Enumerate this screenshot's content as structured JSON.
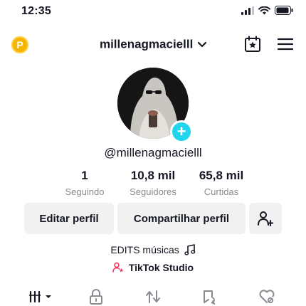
{
  "status": {
    "time": "12:35"
  },
  "header": {
    "username": "millenagmacielll",
    "badge": "P"
  },
  "profile": {
    "handle": "@millenagmacielll",
    "stats": [
      {
        "value": "1",
        "label": "Seguindo"
      },
      {
        "value": "10,8 mil",
        "label": "Seguidores"
      },
      {
        "value": "65,8 mil",
        "label": "Curtidas"
      }
    ],
    "edit_label": "Editar perfil",
    "share_label": "Compartilhar perfil",
    "bio": "EDITS músicas",
    "studio_label": "TikTok Studio"
  },
  "icons": {
    "premium": "p-badge-icon",
    "chevron": "chevron-down-icon",
    "calendar": "calendar-star-icon",
    "menu": "hamburger-menu-icon",
    "add_friend": "add-person-icon",
    "music": "music-note-icon",
    "tabs": [
      "grid-dropdown-icon",
      "lock-icon",
      "repost-icon",
      "favorites-icon",
      "liked-icon"
    ]
  },
  "colors": {
    "accent_cyan": "#20d5ec",
    "badge_gold": "#f5b400",
    "studio_pink": "#fe2c55"
  }
}
